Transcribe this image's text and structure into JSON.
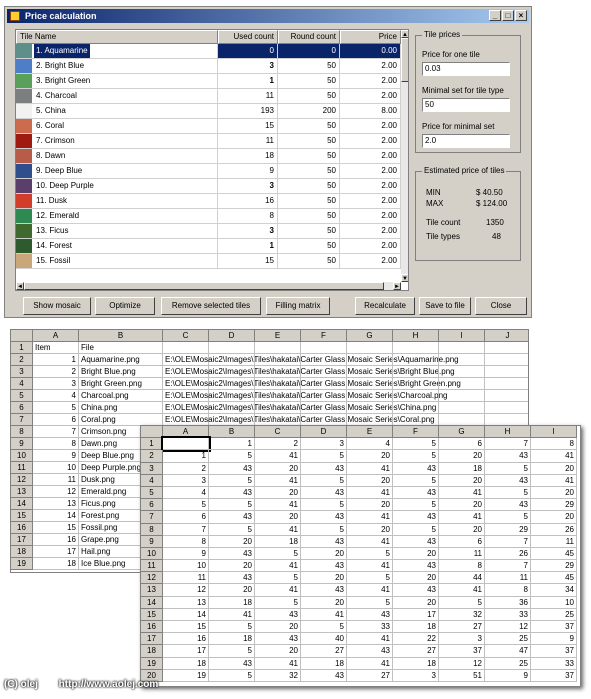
{
  "window": {
    "title": "Price calculation",
    "title_colors": {
      "start": "#0a246a",
      "end": "#a6caf0"
    }
  },
  "grid": {
    "headers": [
      "Tile Name",
      "Used count",
      "Round count",
      "Price"
    ],
    "rows": [
      {
        "name": "1. Aquamarine",
        "used": "0",
        "round": "0",
        "price": "0.00",
        "color": "#5f8f8a",
        "selected": true
      },
      {
        "name": "2. Bright Blue",
        "used": "3",
        "round": "50",
        "price": "2.00",
        "color": "#4f7ec9",
        "bold": true
      },
      {
        "name": "3. Bright Green",
        "used": "1",
        "round": "50",
        "price": "2.00",
        "color": "#5aa05a",
        "bold": true
      },
      {
        "name": "4. Charcoal",
        "used": "11",
        "round": "50",
        "price": "2.00",
        "color": "#7b7f80"
      },
      {
        "name": "5. China",
        "used": "193",
        "round": "200",
        "price": "8.00",
        "color": "#f2f2f0"
      },
      {
        "name": "6. Coral",
        "used": "15",
        "round": "50",
        "price": "2.00",
        "color": "#cc6b4e"
      },
      {
        "name": "7. Crimson",
        "used": "11",
        "round": "50",
        "price": "2.00",
        "color": "#a11a12"
      },
      {
        "name": "8. Dawn",
        "used": "18",
        "round": "50",
        "price": "2.00",
        "color": "#b85c4a"
      },
      {
        "name": "9. Deep Blue",
        "used": "9",
        "round": "50",
        "price": "2.00",
        "color": "#2f4e8c"
      },
      {
        "name": "10. Deep Purple",
        "used": "3",
        "round": "50",
        "price": "2.00",
        "color": "#5a3e6b",
        "bold": true
      },
      {
        "name": "11. Dusk",
        "used": "16",
        "round": "50",
        "price": "2.00",
        "color": "#d23d2b"
      },
      {
        "name": "12. Emerald",
        "used": "8",
        "round": "50",
        "price": "2.00",
        "color": "#2f8a52"
      },
      {
        "name": "13. Ficus",
        "used": "3",
        "round": "50",
        "price": "2.00",
        "color": "#3f6a2f",
        "bold": true
      },
      {
        "name": "14. Forest",
        "used": "1",
        "round": "50",
        "price": "2.00",
        "color": "#2e5a2e",
        "bold": true
      },
      {
        "name": "15. Fossil",
        "used": "15",
        "round": "50",
        "price": "2.00",
        "color": "#c9a77a"
      }
    ]
  },
  "tile_prices": {
    "title": "Tile prices",
    "one_label": "Price for one tile",
    "one_value": "0.03",
    "min_label": "Minimal set for tile type",
    "min_value": "50",
    "set_label": "Price for minimal set",
    "set_value": "2.0"
  },
  "estimate": {
    "title": "Estimated price of tiles",
    "min_label": "MIN",
    "min_value": "$ 40.50",
    "max_label": "MAX",
    "max_value": "$ 124.00",
    "count_label": "Tile count",
    "count_value": "1350",
    "types_label": "Tile types",
    "types_value": "48"
  },
  "buttons": {
    "show": "Show mosaic",
    "optimize": "Optimize",
    "remove": "Remove selected tiles",
    "filling": "Filling matrix",
    "recalculate": "Recalculate",
    "save": "Save to file",
    "close": "Close"
  },
  "sheet1": {
    "cols": [
      "",
      "A",
      "B",
      "C",
      "D",
      "E",
      "F",
      "G",
      "H",
      "I",
      "J"
    ],
    "header_row": [
      "1",
      "Item",
      "File"
    ],
    "rows": [
      [
        "2",
        "1",
        "Aquamarine.png",
        "E:\\OLE\\Mosaic2\\Images\\Tiles\\hakatai\\Carter Glass Mosaic Series\\Aquamarine.png"
      ],
      [
        "3",
        "2",
        "Bright Blue.png",
        "E:\\OLE\\Mosaic2\\Images\\Tiles\\hakatai\\Carter Glass Mosaic Series\\Bright Blue.png"
      ],
      [
        "4",
        "3",
        "Bright Green.png",
        "E:\\OLE\\Mosaic2\\Images\\Tiles\\hakatai\\Carter Glass Mosaic Series\\Bright Green.png"
      ],
      [
        "5",
        "4",
        "Charcoal.png",
        "E:\\OLE\\Mosaic2\\Images\\Tiles\\hakatai\\Carter Glass Mosaic Series\\Charcoal.png"
      ],
      [
        "6",
        "5",
        "China.png",
        "E:\\OLE\\Mosaic2\\Images\\Tiles\\hakatai\\Carter Glass Mosaic Series\\China.png"
      ],
      [
        "7",
        "6",
        "Coral.png",
        "E:\\OLE\\Mosaic2\\Images\\Tiles\\hakatai\\Carter Glass Mosaic Series\\Coral.png"
      ],
      [
        "8",
        "7",
        "Crimson.png",
        ""
      ],
      [
        "9",
        "8",
        "Dawn.png",
        ""
      ],
      [
        "10",
        "9",
        "Deep Blue.png",
        ""
      ],
      [
        "11",
        "10",
        "Deep Purple.png",
        ""
      ],
      [
        "12",
        "11",
        "Dusk.png",
        ""
      ],
      [
        "13",
        "12",
        "Emerald.png",
        ""
      ],
      [
        "14",
        "13",
        "Ficus.png",
        ""
      ],
      [
        "15",
        "14",
        "Forest.png",
        ""
      ],
      [
        "16",
        "15",
        "Fossil.png",
        ""
      ],
      [
        "17",
        "16",
        "Grape.png",
        ""
      ],
      [
        "18",
        "17",
        "Hail.png",
        ""
      ],
      [
        "19",
        "18",
        "Ice Blue.png",
        ""
      ]
    ]
  },
  "sheet2": {
    "cols": [
      "",
      "A",
      "B",
      "C",
      "D",
      "E",
      "F",
      "G",
      "H",
      "I"
    ],
    "rows": [
      [
        "1",
        "",
        "1",
        "2",
        "3",
        "4",
        "5",
        "6",
        "7",
        "8"
      ],
      [
        "2",
        "1",
        "5",
        "41",
        "5",
        "20",
        "5",
        "20",
        "43",
        "41"
      ],
      [
        "3",
        "2",
        "43",
        "20",
        "43",
        "41",
        "43",
        "18",
        "5",
        "20"
      ],
      [
        "4",
        "3",
        "5",
        "41",
        "5",
        "20",
        "5",
        "20",
        "43",
        "41"
      ],
      [
        "5",
        "4",
        "43",
        "20",
        "43",
        "41",
        "43",
        "41",
        "5",
        "20"
      ],
      [
        "6",
        "5",
        "5",
        "41",
        "5",
        "20",
        "5",
        "20",
        "43",
        "29"
      ],
      [
        "7",
        "6",
        "43",
        "20",
        "43",
        "41",
        "43",
        "41",
        "5",
        "20"
      ],
      [
        "8",
        "7",
        "5",
        "41",
        "5",
        "20",
        "5",
        "20",
        "29",
        "26"
      ],
      [
        "9",
        "8",
        "20",
        "18",
        "43",
        "41",
        "43",
        "6",
        "7",
        "11"
      ],
      [
        "10",
        "9",
        "43",
        "5",
        "20",
        "5",
        "20",
        "11",
        "26",
        "45"
      ],
      [
        "11",
        "10",
        "20",
        "41",
        "43",
        "41",
        "43",
        "8",
        "7",
        "29"
      ],
      [
        "12",
        "11",
        "43",
        "5",
        "20",
        "5",
        "20",
        "44",
        "11",
        "45"
      ],
      [
        "13",
        "12",
        "20",
        "41",
        "43",
        "41",
        "43",
        "41",
        "8",
        "34"
      ],
      [
        "14",
        "13",
        "18",
        "5",
        "20",
        "5",
        "20",
        "5",
        "36",
        "10"
      ],
      [
        "15",
        "14",
        "41",
        "43",
        "41",
        "43",
        "17",
        "32",
        "33",
        "25"
      ],
      [
        "16",
        "15",
        "5",
        "20",
        "5",
        "33",
        "18",
        "27",
        "12",
        "37"
      ],
      [
        "17",
        "16",
        "18",
        "43",
        "40",
        "41",
        "22",
        "3",
        "25",
        "9"
      ],
      [
        "18",
        "17",
        "5",
        "20",
        "27",
        "43",
        "27",
        "37",
        "47",
        "37"
      ],
      [
        "19",
        "18",
        "43",
        "41",
        "18",
        "41",
        "18",
        "12",
        "25",
        "33"
      ],
      [
        "20",
        "19",
        "5",
        "32",
        "43",
        "27",
        "3",
        "51",
        "9",
        "37"
      ]
    ]
  },
  "footer": {
    "copyright": "(C) olej",
    "url": "http://www.aolej.com"
  }
}
